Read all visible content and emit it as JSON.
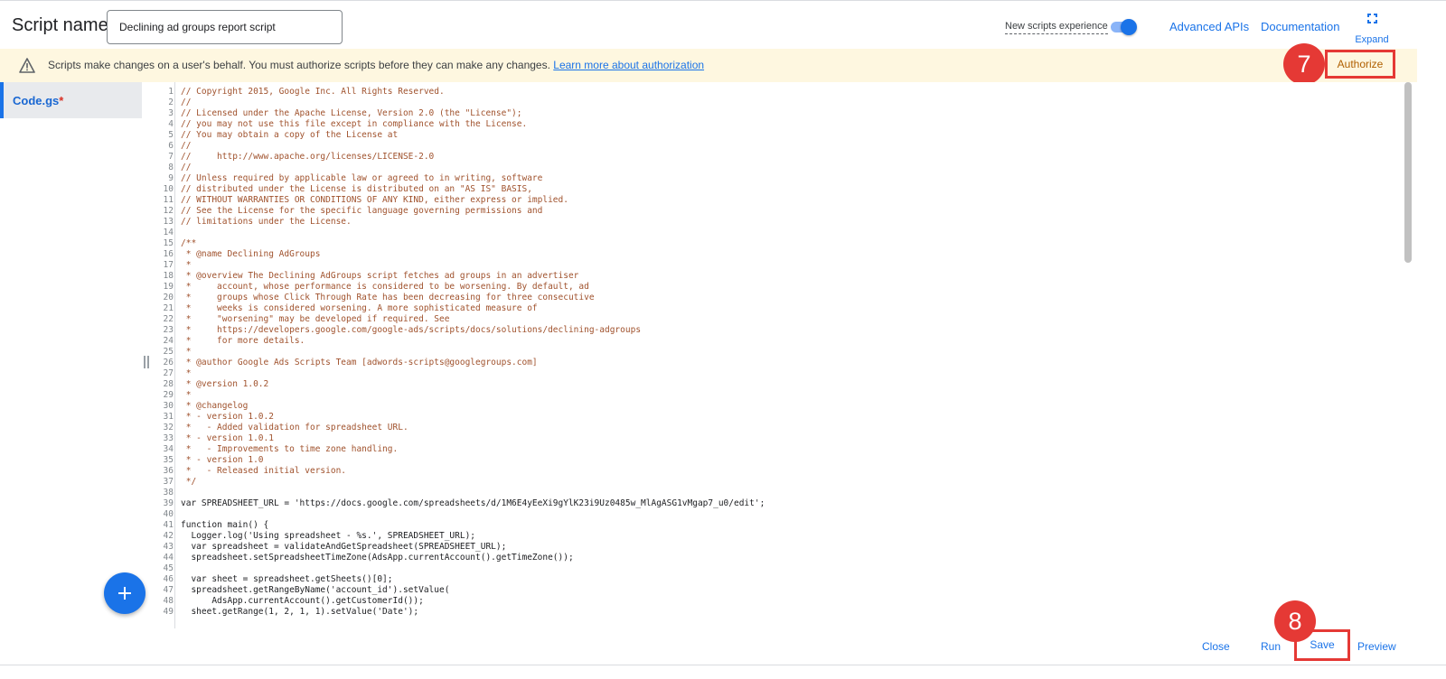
{
  "header": {
    "script_name_label": "Script name:",
    "script_name_value": "Declining ad groups report script",
    "new_experience_label": "New scripts experience",
    "new_experience_enabled": true,
    "advanced_apis": "Advanced APIs",
    "documentation": "Documentation",
    "expand": "Expand"
  },
  "banner": {
    "icon": "warning-icon",
    "text": "Scripts make changes on a user's behalf. You must authorize scripts before they can make any changes.",
    "link": "Learn more about authorization",
    "authorize": "Authorize"
  },
  "annotations": {
    "step_authorize": "7",
    "step_save": "8",
    "highlight_color": "#e53935"
  },
  "files": [
    {
      "name": "Code.gs",
      "modified_marker": "*"
    }
  ],
  "editor": {
    "lines": [
      {
        "n": "1",
        "text": "// Copyright 2015, Google Inc. All Rights Reserved."
      },
      {
        "n": "2",
        "text": "//"
      },
      {
        "n": "3",
        "text": "// Licensed under the Apache License, Version 2.0 (the \"License\");"
      },
      {
        "n": "4",
        "text": "// you may not use this file except in compliance with the License."
      },
      {
        "n": "5",
        "text": "// You may obtain a copy of the License at"
      },
      {
        "n": "6",
        "text": "//"
      },
      {
        "n": "7",
        "text": "//     http://www.apache.org/licenses/LICENSE-2.0"
      },
      {
        "n": "8",
        "text": "//"
      },
      {
        "n": "9",
        "text": "// Unless required by applicable law or agreed to in writing, software"
      },
      {
        "n": "10",
        "text": "// distributed under the License is distributed on an \"AS IS\" BASIS,"
      },
      {
        "n": "11",
        "text": "// WITHOUT WARRANTIES OR CONDITIONS OF ANY KIND, either express or implied."
      },
      {
        "n": "12",
        "text": "// See the License for the specific language governing permissions and"
      },
      {
        "n": "13",
        "text": "// limitations under the License."
      },
      {
        "n": "14",
        "text": ""
      },
      {
        "n": "15",
        "text": "/**"
      },
      {
        "n": "16",
        "text": " * @name Declining AdGroups"
      },
      {
        "n": "17",
        "text": " *"
      },
      {
        "n": "18",
        "text": " * @overview The Declining AdGroups script fetches ad groups in an advertiser"
      },
      {
        "n": "19",
        "text": " *     account, whose performance is considered to be worsening. By default, ad"
      },
      {
        "n": "20",
        "text": " *     groups whose Click Through Rate has been decreasing for three consecutive"
      },
      {
        "n": "21",
        "text": " *     weeks is considered worsening. A more sophisticated measure of"
      },
      {
        "n": "22",
        "text": " *     \"worsening\" may be developed if required. See"
      },
      {
        "n": "23",
        "text": " *     https://developers.google.com/google-ads/scripts/docs/solutions/declining-adgroups"
      },
      {
        "n": "24",
        "text": " *     for more details."
      },
      {
        "n": "25",
        "text": " *"
      },
      {
        "n": "26",
        "text": " * @author Google Ads Scripts Team [adwords-scripts@googlegroups.com]"
      },
      {
        "n": "27",
        "text": " *"
      },
      {
        "n": "28",
        "text": " * @version 1.0.2"
      },
      {
        "n": "29",
        "text": " *"
      },
      {
        "n": "30",
        "text": " * @changelog"
      },
      {
        "n": "31",
        "text": " * - version 1.0.2"
      },
      {
        "n": "32",
        "text": " *   - Added validation for spreadsheet URL."
      },
      {
        "n": "33",
        "text": " * - version 1.0.1"
      },
      {
        "n": "34",
        "text": " *   - Improvements to time zone handling."
      },
      {
        "n": "35",
        "text": " * - version 1.0"
      },
      {
        "n": "36",
        "text": " *   - Released initial version."
      },
      {
        "n": "37",
        "text": " */"
      },
      {
        "n": "38",
        "text": ""
      },
      {
        "n": "39",
        "text": "var SPREADSHEET_URL = 'https://docs.google.com/spreadsheets/d/1M6E4yEeXi9gYlK23i9Uz0485w_MlAgASG1vMgap7_u0/edit';"
      },
      {
        "n": "40",
        "text": ""
      },
      {
        "n": "41",
        "text": "function main() {"
      },
      {
        "n": "42",
        "text": "  Logger.log('Using spreadsheet - %s.', SPREADSHEET_URL);"
      },
      {
        "n": "43",
        "text": "  var spreadsheet = validateAndGetSpreadsheet(SPREADSHEET_URL);"
      },
      {
        "n": "44",
        "text": "  spreadsheet.setSpreadsheetTimeZone(AdsApp.currentAccount().getTimeZone());"
      },
      {
        "n": "45",
        "text": ""
      },
      {
        "n": "46",
        "text": "  var sheet = spreadsheet.getSheets()[0];"
      },
      {
        "n": "47",
        "text": "  spreadsheet.getRangeByName('account_id').setValue("
      },
      {
        "n": "48",
        "text": "      AdsApp.currentAccount().getCustomerId());"
      },
      {
        "n": "49",
        "text": "  sheet.getRange(1, 2, 1, 1).setValue('Date');"
      }
    ],
    "comment_color": "#a0522d",
    "code_color": "#202124",
    "string_color": "#a31515",
    "keyword_color": "#0000cc"
  },
  "footer": {
    "close": "Close",
    "run": "Run",
    "save": "Save",
    "preview": "Preview"
  },
  "colors": {
    "accent": "#1a73e8",
    "banner_bg": "#fef7e0",
    "annotation": "#e53935"
  }
}
